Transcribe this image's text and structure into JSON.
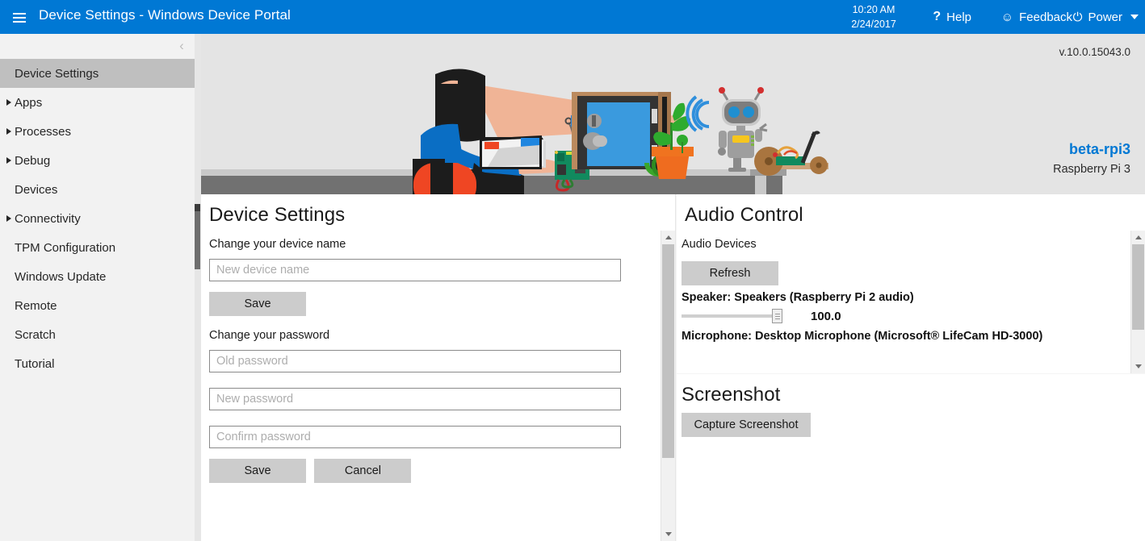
{
  "topbar": {
    "menu_icon": "hamburger-icon",
    "title": "Device Settings - Windows Device Portal",
    "time": "10:20 AM",
    "date": "2/24/2017",
    "help_icon": "?",
    "help_label": "Help",
    "feedback_icon": "☺",
    "feedback_label": "Feedback",
    "power_icon": "⏻",
    "power_label": "Power",
    "accent_color": "#0078d4"
  },
  "sidebar": {
    "collapse_icon": "‹",
    "items": [
      {
        "label": "Device Settings",
        "expandable": false,
        "selected": true
      },
      {
        "label": "Apps",
        "expandable": true,
        "selected": false
      },
      {
        "label": "Processes",
        "expandable": true,
        "selected": false
      },
      {
        "label": "Debug",
        "expandable": true,
        "selected": false
      },
      {
        "label": "Devices",
        "expandable": false,
        "selected": false
      },
      {
        "label": "Connectivity",
        "expandable": true,
        "selected": false
      },
      {
        "label": "TPM Configuration",
        "expandable": false,
        "selected": false
      },
      {
        "label": "Windows Update",
        "expandable": false,
        "selected": false
      },
      {
        "label": "Remote",
        "expandable": false,
        "selected": false
      },
      {
        "label": "Scratch",
        "expandable": false,
        "selected": false
      },
      {
        "label": "Tutorial",
        "expandable": false,
        "selected": false
      }
    ]
  },
  "banner": {
    "version": "v.10.0.15043.0",
    "device_name": "beta-rpi3",
    "device_model": "Raspberry Pi 3",
    "device_name_color": "#0078d4",
    "illustration": "iot-desk-scene-illustration"
  },
  "device_settings": {
    "title": "Device Settings",
    "device_name_label": "Change your device name",
    "device_name_placeholder": "New device name",
    "device_name_value": "",
    "device_name_save_label": "Save",
    "password_label": "Change your password",
    "old_password_placeholder": "Old password",
    "old_password_value": "",
    "new_password_placeholder": "New password",
    "new_password_value": "",
    "confirm_password_placeholder": "Confirm password",
    "confirm_password_value": "",
    "password_save_label": "Save",
    "password_cancel_label": "Cancel"
  },
  "audio_control": {
    "title": "Audio Control",
    "devices_label": "Audio Devices",
    "refresh_label": "Refresh",
    "speaker_label": "Speaker: Speakers (Raspberry Pi 2 audio)",
    "speaker_volume": "100.0",
    "microphone_label": "Microphone: Desktop Microphone (Microsoft® LifeCam HD-3000)"
  },
  "screenshot": {
    "title": "Screenshot",
    "capture_label": "Capture Screenshot"
  }
}
